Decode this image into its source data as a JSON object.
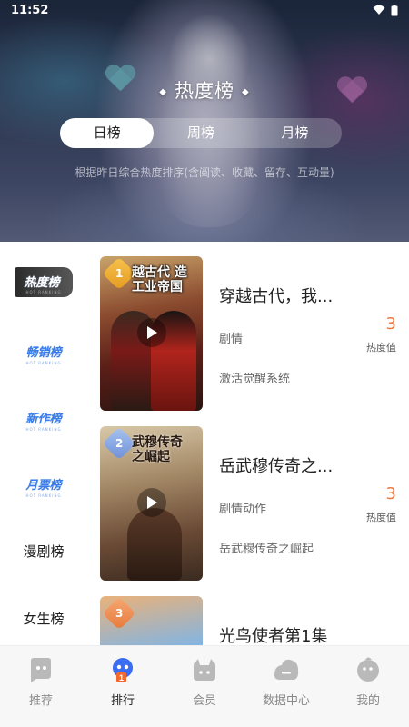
{
  "status_bar": {
    "time": "11:52"
  },
  "hero": {
    "title": "热度榜",
    "tabs": [
      {
        "label": "日榜",
        "active": true
      },
      {
        "label": "周榜",
        "active": false
      },
      {
        "label": "月榜",
        "active": false
      }
    ],
    "description": "根据昨日综合热度排序(含阅读、收藏、留存、互动量)"
  },
  "sidebar": {
    "items": [
      {
        "label": "热度榜",
        "sub": "HOT RANKING",
        "active": true,
        "style": "badge"
      },
      {
        "label": "畅销榜",
        "sub": "HOT RANKING",
        "active": false,
        "style": "badge"
      },
      {
        "label": "新作榜",
        "sub": "HOT RANKING",
        "active": false,
        "style": "badge"
      },
      {
        "label": "月票榜",
        "sub": "HOT RANKING",
        "active": false,
        "style": "badge"
      },
      {
        "label": "漫剧榜",
        "active": false,
        "style": "plain"
      },
      {
        "label": "女生榜",
        "active": false,
        "style": "plain"
      }
    ]
  },
  "list": [
    {
      "rank": "1",
      "cover_text": "越古代 造工业帝国",
      "title": "穿越古代，我...",
      "genre": "剧情",
      "desc": "激活觉醒系统",
      "heat": "3",
      "heat_label": "热度值"
    },
    {
      "rank": "2",
      "cover_text": "武穆传奇 之崛起",
      "title": "岳武穆传奇之...",
      "genre": "剧情动作",
      "desc": "岳武穆传奇之崛起",
      "heat": "3",
      "heat_label": "热度值"
    },
    {
      "rank": "3",
      "cover_text": "",
      "title": "光鸟使者第1集",
      "genre": "",
      "desc": "",
      "heat": "",
      "heat_label": ""
    }
  ],
  "bottom_nav": {
    "items": [
      {
        "label": "推荐",
        "icon": "recommend-icon",
        "active": false
      },
      {
        "label": "排行",
        "icon": "ranking-icon",
        "active": true
      },
      {
        "label": "会员",
        "icon": "member-icon",
        "active": false
      },
      {
        "label": "数据中心",
        "icon": "data-center-icon",
        "active": false
      },
      {
        "label": "我的",
        "icon": "profile-icon",
        "active": false
      }
    ]
  },
  "colors": {
    "accent": "#f0793f",
    "active_badge_bg": "#2b2b2b",
    "badge_blue": "#3a7de8"
  }
}
